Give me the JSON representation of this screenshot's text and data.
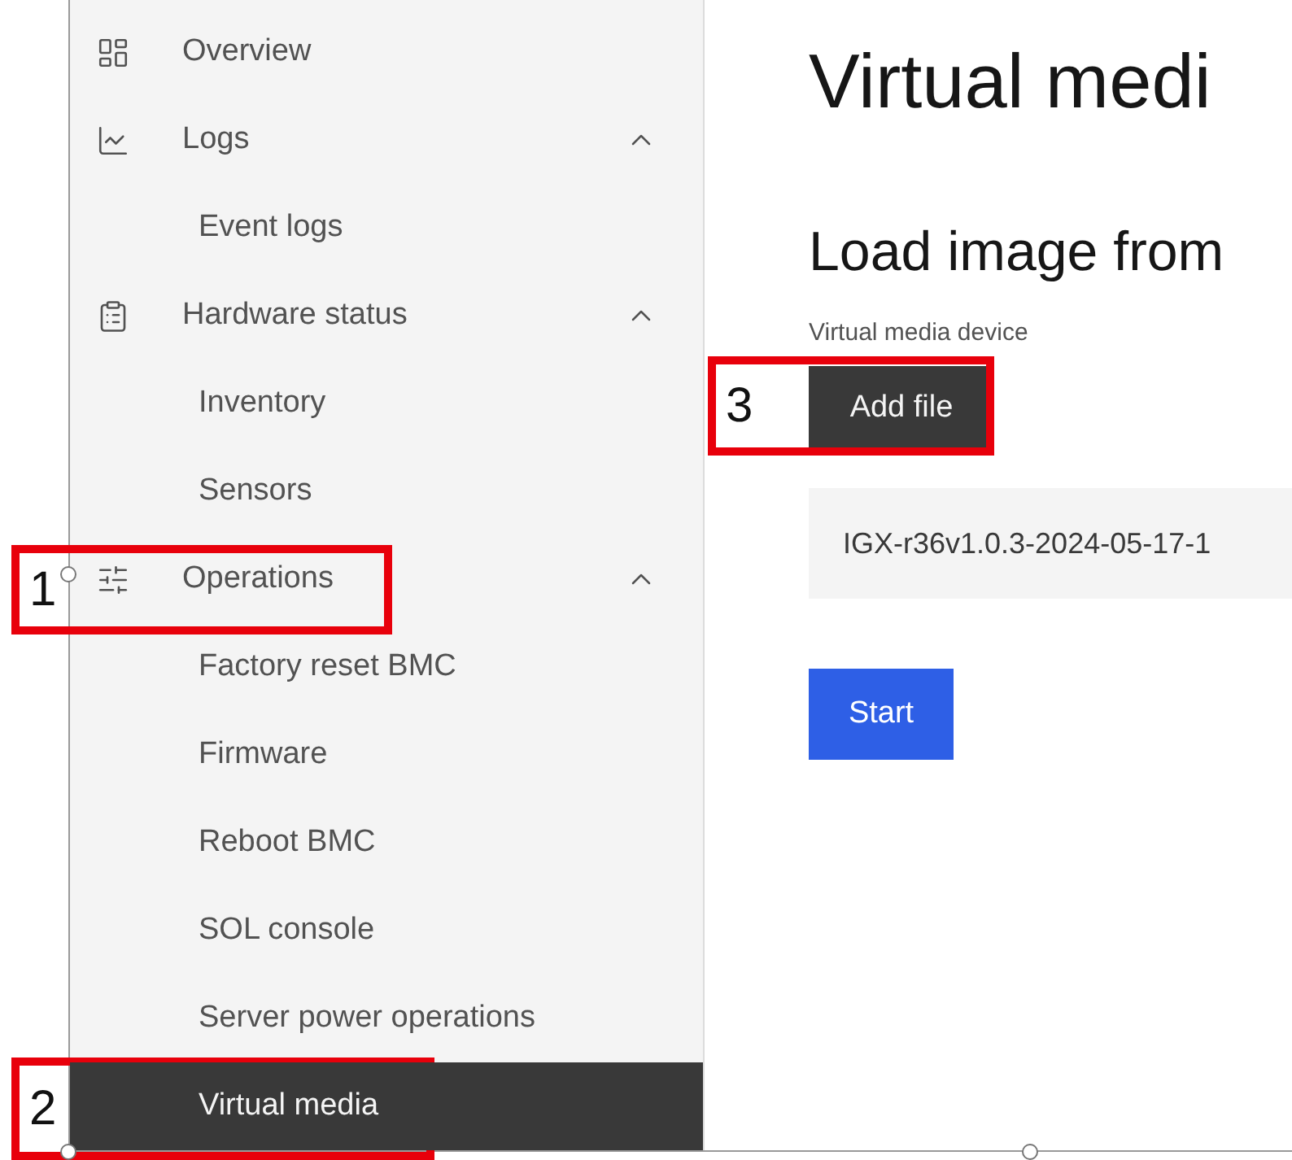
{
  "sidebar": {
    "items": [
      {
        "label": "Overview",
        "selected": false
      },
      {
        "label": "Logs",
        "selected": false,
        "expanded": true,
        "children": [
          {
            "label": "Event logs",
            "selected": false
          }
        ]
      },
      {
        "label": "Hardware status",
        "selected": false,
        "expanded": true,
        "children": [
          {
            "label": "Inventory",
            "selected": false
          },
          {
            "label": "Sensors",
            "selected": false
          }
        ]
      },
      {
        "label": "Operations",
        "selected": false,
        "expanded": true,
        "annotation": "1",
        "children": [
          {
            "label": "Factory reset BMC",
            "selected": false
          },
          {
            "label": "Firmware",
            "selected": false
          },
          {
            "label": "Reboot BMC",
            "selected": false
          },
          {
            "label": "SOL console",
            "selected": false
          },
          {
            "label": "Server power operations",
            "selected": false
          },
          {
            "label": "Virtual media",
            "selected": true,
            "annotation": "2"
          }
        ]
      }
    ]
  },
  "main": {
    "title": "Virtual medi",
    "section_title": "Load image from",
    "device_label": "Virtual media device",
    "add_file_button": {
      "label": "Add file",
      "annotation": "3"
    },
    "file_name": "IGX-r36v1.0.3-2024-05-17-1",
    "start_button": "Start"
  }
}
